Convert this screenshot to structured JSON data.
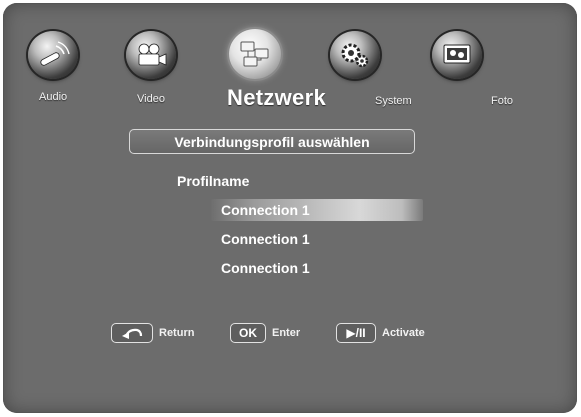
{
  "tabs": [
    {
      "label": "Audio",
      "icon": "microphone-icon",
      "active": false
    },
    {
      "label": "Video",
      "icon": "camera-icon",
      "active": false
    },
    {
      "label": "Netzwerk",
      "icon": "network-icon",
      "active": true
    },
    {
      "label": "System",
      "icon": "gears-icon",
      "active": false
    },
    {
      "label": "Foto",
      "icon": "photo-icon",
      "active": false
    }
  ],
  "section": {
    "title": "Verbindungsprofil auswählen"
  },
  "profiles": {
    "heading": "Profilname",
    "items": [
      "Connection 1",
      "Connection 1",
      "Connection 1"
    ],
    "selected_index": 0
  },
  "controls": [
    {
      "key": "return-arrow",
      "label": "Return"
    },
    {
      "key": "OK",
      "label": "Enter"
    },
    {
      "key": "▶/II",
      "label": "Activate"
    }
  ],
  "colors": {
    "background": "#6c6c6c",
    "text": "#ffffff",
    "highlight": "#d8d8d8"
  }
}
